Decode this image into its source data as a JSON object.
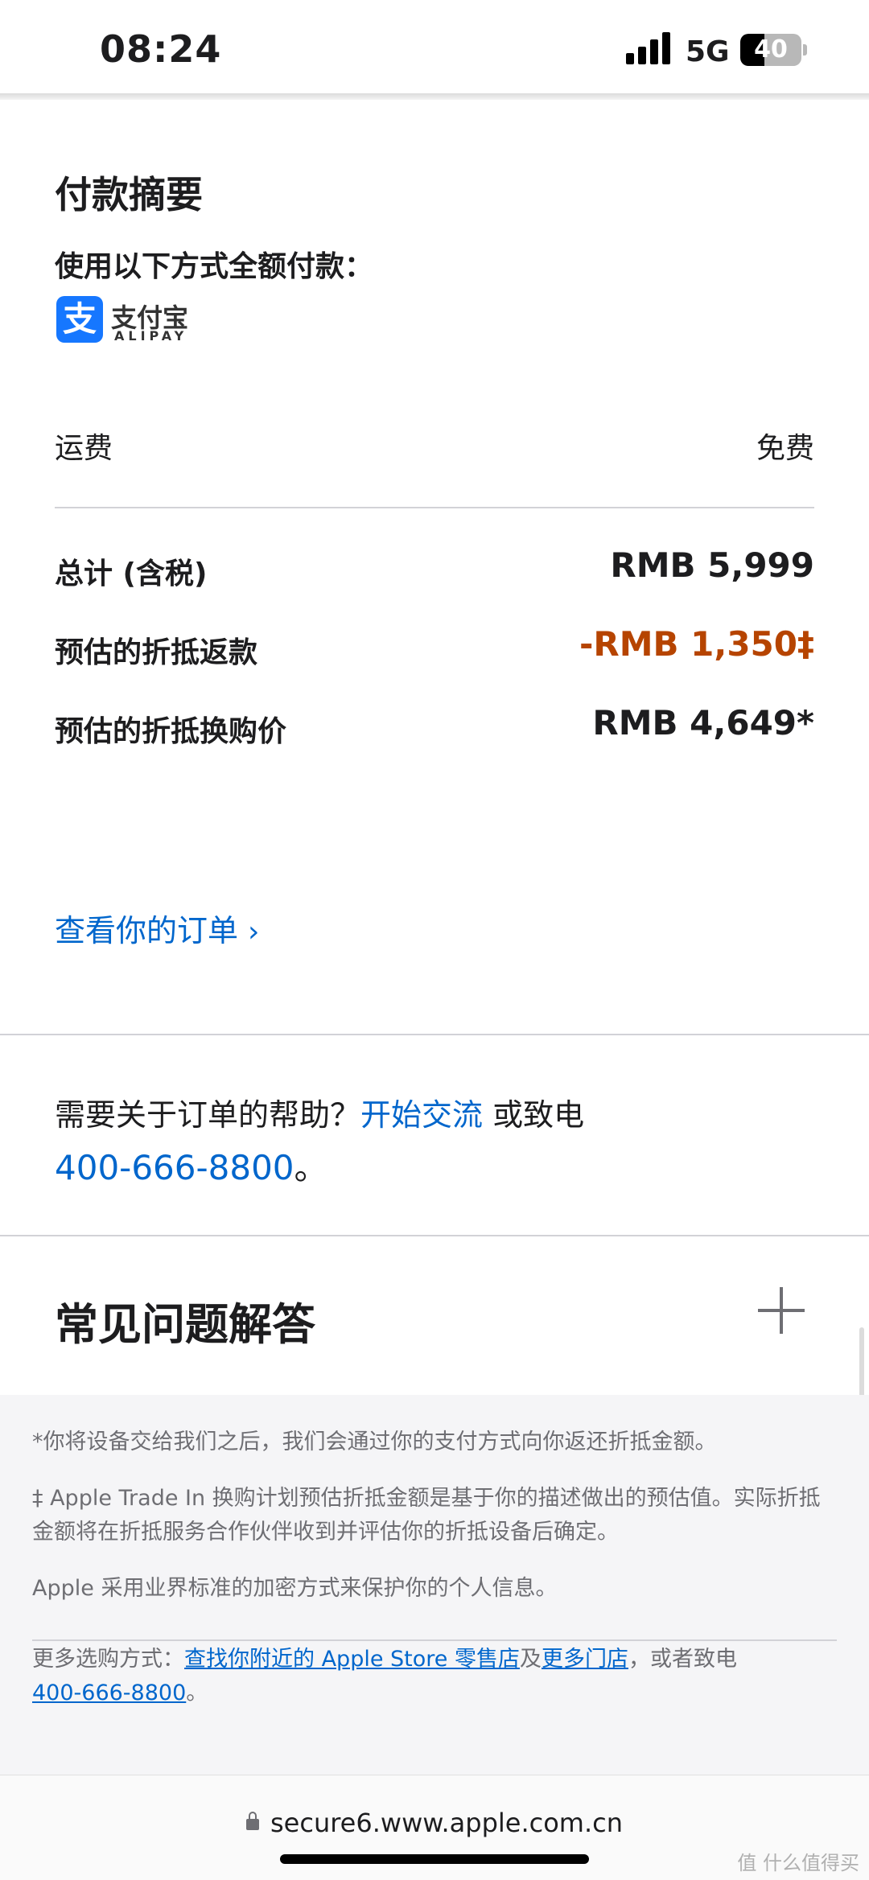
{
  "status_bar": {
    "time": "08:24",
    "network": "5G",
    "battery": "40",
    "battery_level": 0.4
  },
  "summary": {
    "title": "付款摘要",
    "payment_desc": "使用以下方式全额付款：",
    "alipay_cn": "支付宝",
    "alipay_en": "ALIPAY",
    "alipay_glyph": "支",
    "shipping_label": "运费",
    "shipping_value": "免费",
    "total_label": "总计 (含税)",
    "total_value": "RMB 5,999",
    "rebate_label": "预估的折抵返款",
    "rebate_value": "-RMB 1,350‡",
    "tradein_label": "预估的折抵换购价",
    "tradein_value": "RMB 4,649*",
    "rebate_color": "#b64400"
  },
  "order_link": {
    "label": "查看你的订单",
    "chevron": "›"
  },
  "help": {
    "prefix": "需要关于订单的帮助？",
    "chat_link": "开始交流",
    "middle": " 或致电",
    "phone": "400-666-8800",
    "suffix": "。"
  },
  "faq": {
    "title": "常见问题解答"
  },
  "footer": {
    "note1": "*你将设备交给我们之后，我们会通过你的支付方式向你返还折抵金额。",
    "note2": "‡ Apple Trade In 换购计划预估折抵金额是基于你的描述做出的预估值。实际折抵金额将在折抵服务合作伙伴收到并评估你的折抵设备后确定。",
    "note3": "Apple 采用业界标准的加密方式来保护你的个人信息。",
    "more_prefix": "更多选购方式：",
    "find_store_link": "查找你附近的 Apple Store 零售店",
    "and": "及",
    "more_stores_link": "更多门店",
    "or_call": "，或者致电",
    "phone_link": "400-666-8800",
    "end": "。"
  },
  "browser": {
    "url": "secure6.www.apple.com.cn"
  },
  "watermark": "值 什么值得买",
  "colors": {
    "link": "#0066cc",
    "text": "#1d1d1f",
    "footer_bg": "#f5f5f7"
  }
}
